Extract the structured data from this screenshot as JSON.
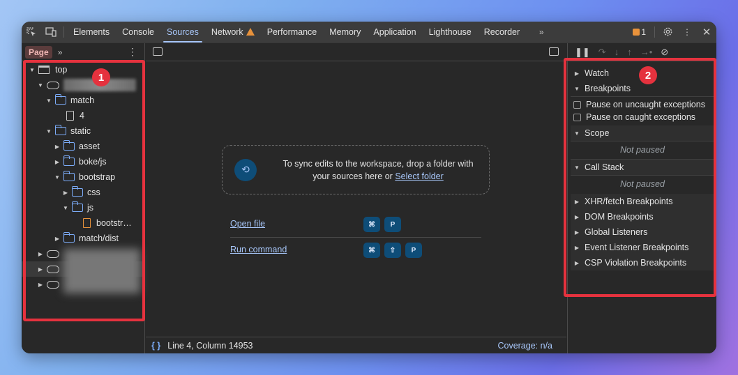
{
  "tabs": [
    {
      "label": "Elements"
    },
    {
      "label": "Console"
    },
    {
      "label": "Sources",
      "active": true
    },
    {
      "label": "Network",
      "warning": true
    },
    {
      "label": "Performance"
    },
    {
      "label": "Memory"
    },
    {
      "label": "Application"
    },
    {
      "label": "Lighthouse"
    },
    {
      "label": "Recorder"
    }
  ],
  "issues_count": "1",
  "navigator": {
    "tab_label": "Page",
    "tree": {
      "top": "top",
      "match": "match",
      "file_4": "4",
      "static": "static",
      "asset": "asset",
      "boke": "boke/js",
      "bootstrap": "bootstrap",
      "css": "css",
      "js": "js",
      "bootstrap_file": "bootstr…",
      "match_dist": "match/dist"
    }
  },
  "editor": {
    "drop_text": "To sync edits to the workspace, drop a folder with your sources here or",
    "select_folder": "Select folder",
    "open_file": "Open file",
    "run_command": "Run command",
    "open_file_keys": [
      "⌘",
      "P"
    ],
    "run_command_keys": [
      "⌘",
      "⇧",
      "P"
    ]
  },
  "status": {
    "position": "Line 4, Column 14953",
    "coverage": "Coverage: n/a"
  },
  "debugger": {
    "watch": "Watch",
    "breakpoints": "Breakpoints",
    "pause_uncaught": "Pause on uncaught exceptions",
    "pause_caught": "Pause on caught exceptions",
    "scope": "Scope",
    "not_paused": "Not paused",
    "call_stack": "Call Stack",
    "xhr": "XHR/fetch Breakpoints",
    "dom": "DOM Breakpoints",
    "global": "Global Listeners",
    "event": "Event Listener Breakpoints",
    "csp": "CSP Violation Breakpoints"
  },
  "annotations": {
    "one": "1",
    "two": "2"
  },
  "colors": {
    "accent": "#a8c7fa",
    "annotation": "#e5323e",
    "warning": "#e8923b"
  }
}
